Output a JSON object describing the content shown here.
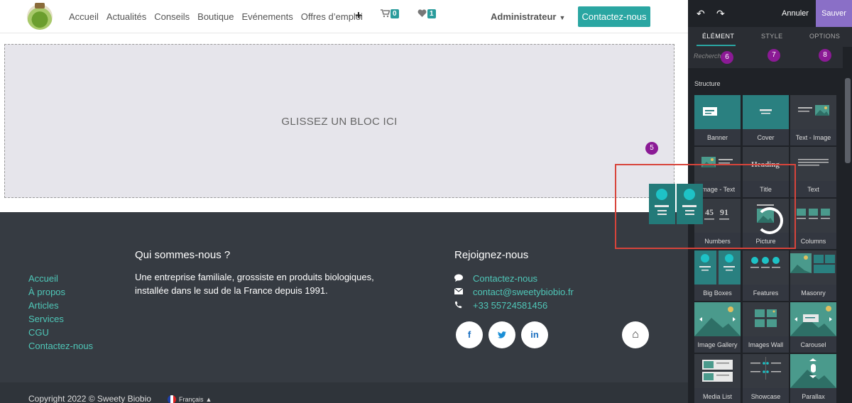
{
  "header": {
    "nav": [
      "Accueil",
      "Actualités",
      "Conseils",
      "Boutique",
      "Evénements",
      "Offres d’emploi"
    ],
    "plus_icon": "+",
    "cart_count": "0",
    "wishlist_count": "1",
    "user": "Administrateur",
    "contact_button": "Contactez-nous"
  },
  "dropzone": {
    "label": "GLISSEZ UN BLOC ICI"
  },
  "markers": [
    "5",
    "6",
    "7",
    "8"
  ],
  "footer": {
    "links": [
      "Accueil",
      "À propos",
      "Articles",
      "Services",
      "CGU",
      "Contactez-nous"
    ],
    "about_title": "Qui sommes-nous ?",
    "about_text": "Une entreprise familiale, grossiste en produits biologiques, installée dans le sud de la France depuis 1991.",
    "join_title": "Rejoignez-nous",
    "contact_link": "Contactez-nous",
    "email": "contact@sweetybiobio.fr",
    "phone": "+33 55724581456",
    "social": {
      "facebook": "f",
      "twitter": "t",
      "linkedin": "in",
      "home": "⌂"
    },
    "copyright": "Copyright 2022 © Sweety Biobio",
    "language": "Français"
  },
  "editor": {
    "undo_icon": "↶",
    "redo_icon": "↷",
    "cancel_label": "Annuler",
    "save_label": "Sauver",
    "tabs": [
      "ÉLÉMENT",
      "STYLE",
      "OPTIONS"
    ],
    "search_placeholder": "Recherche",
    "section_title": "Structure",
    "snippets": [
      "Banner",
      "Cover",
      "Text - Image",
      "Image - Text",
      "Title",
      "Text",
      "Numbers",
      "Picture",
      "Columns",
      "Big Boxes",
      "Features",
      "Masonry",
      "Image Gallery",
      "Images Wall",
      "Carousel",
      "Media List",
      "Showcase",
      "Parallax"
    ],
    "title_thumb_text": "Heading",
    "numbers_thumb": [
      "45",
      "91"
    ]
  },
  "colors": {
    "accent": "#2aa6a2",
    "link": "#4fc7b8",
    "footer_bg": "#363b42",
    "save": "#8a6fc7",
    "marker": "#8b1a95",
    "drag_outline": "#d8443b"
  }
}
